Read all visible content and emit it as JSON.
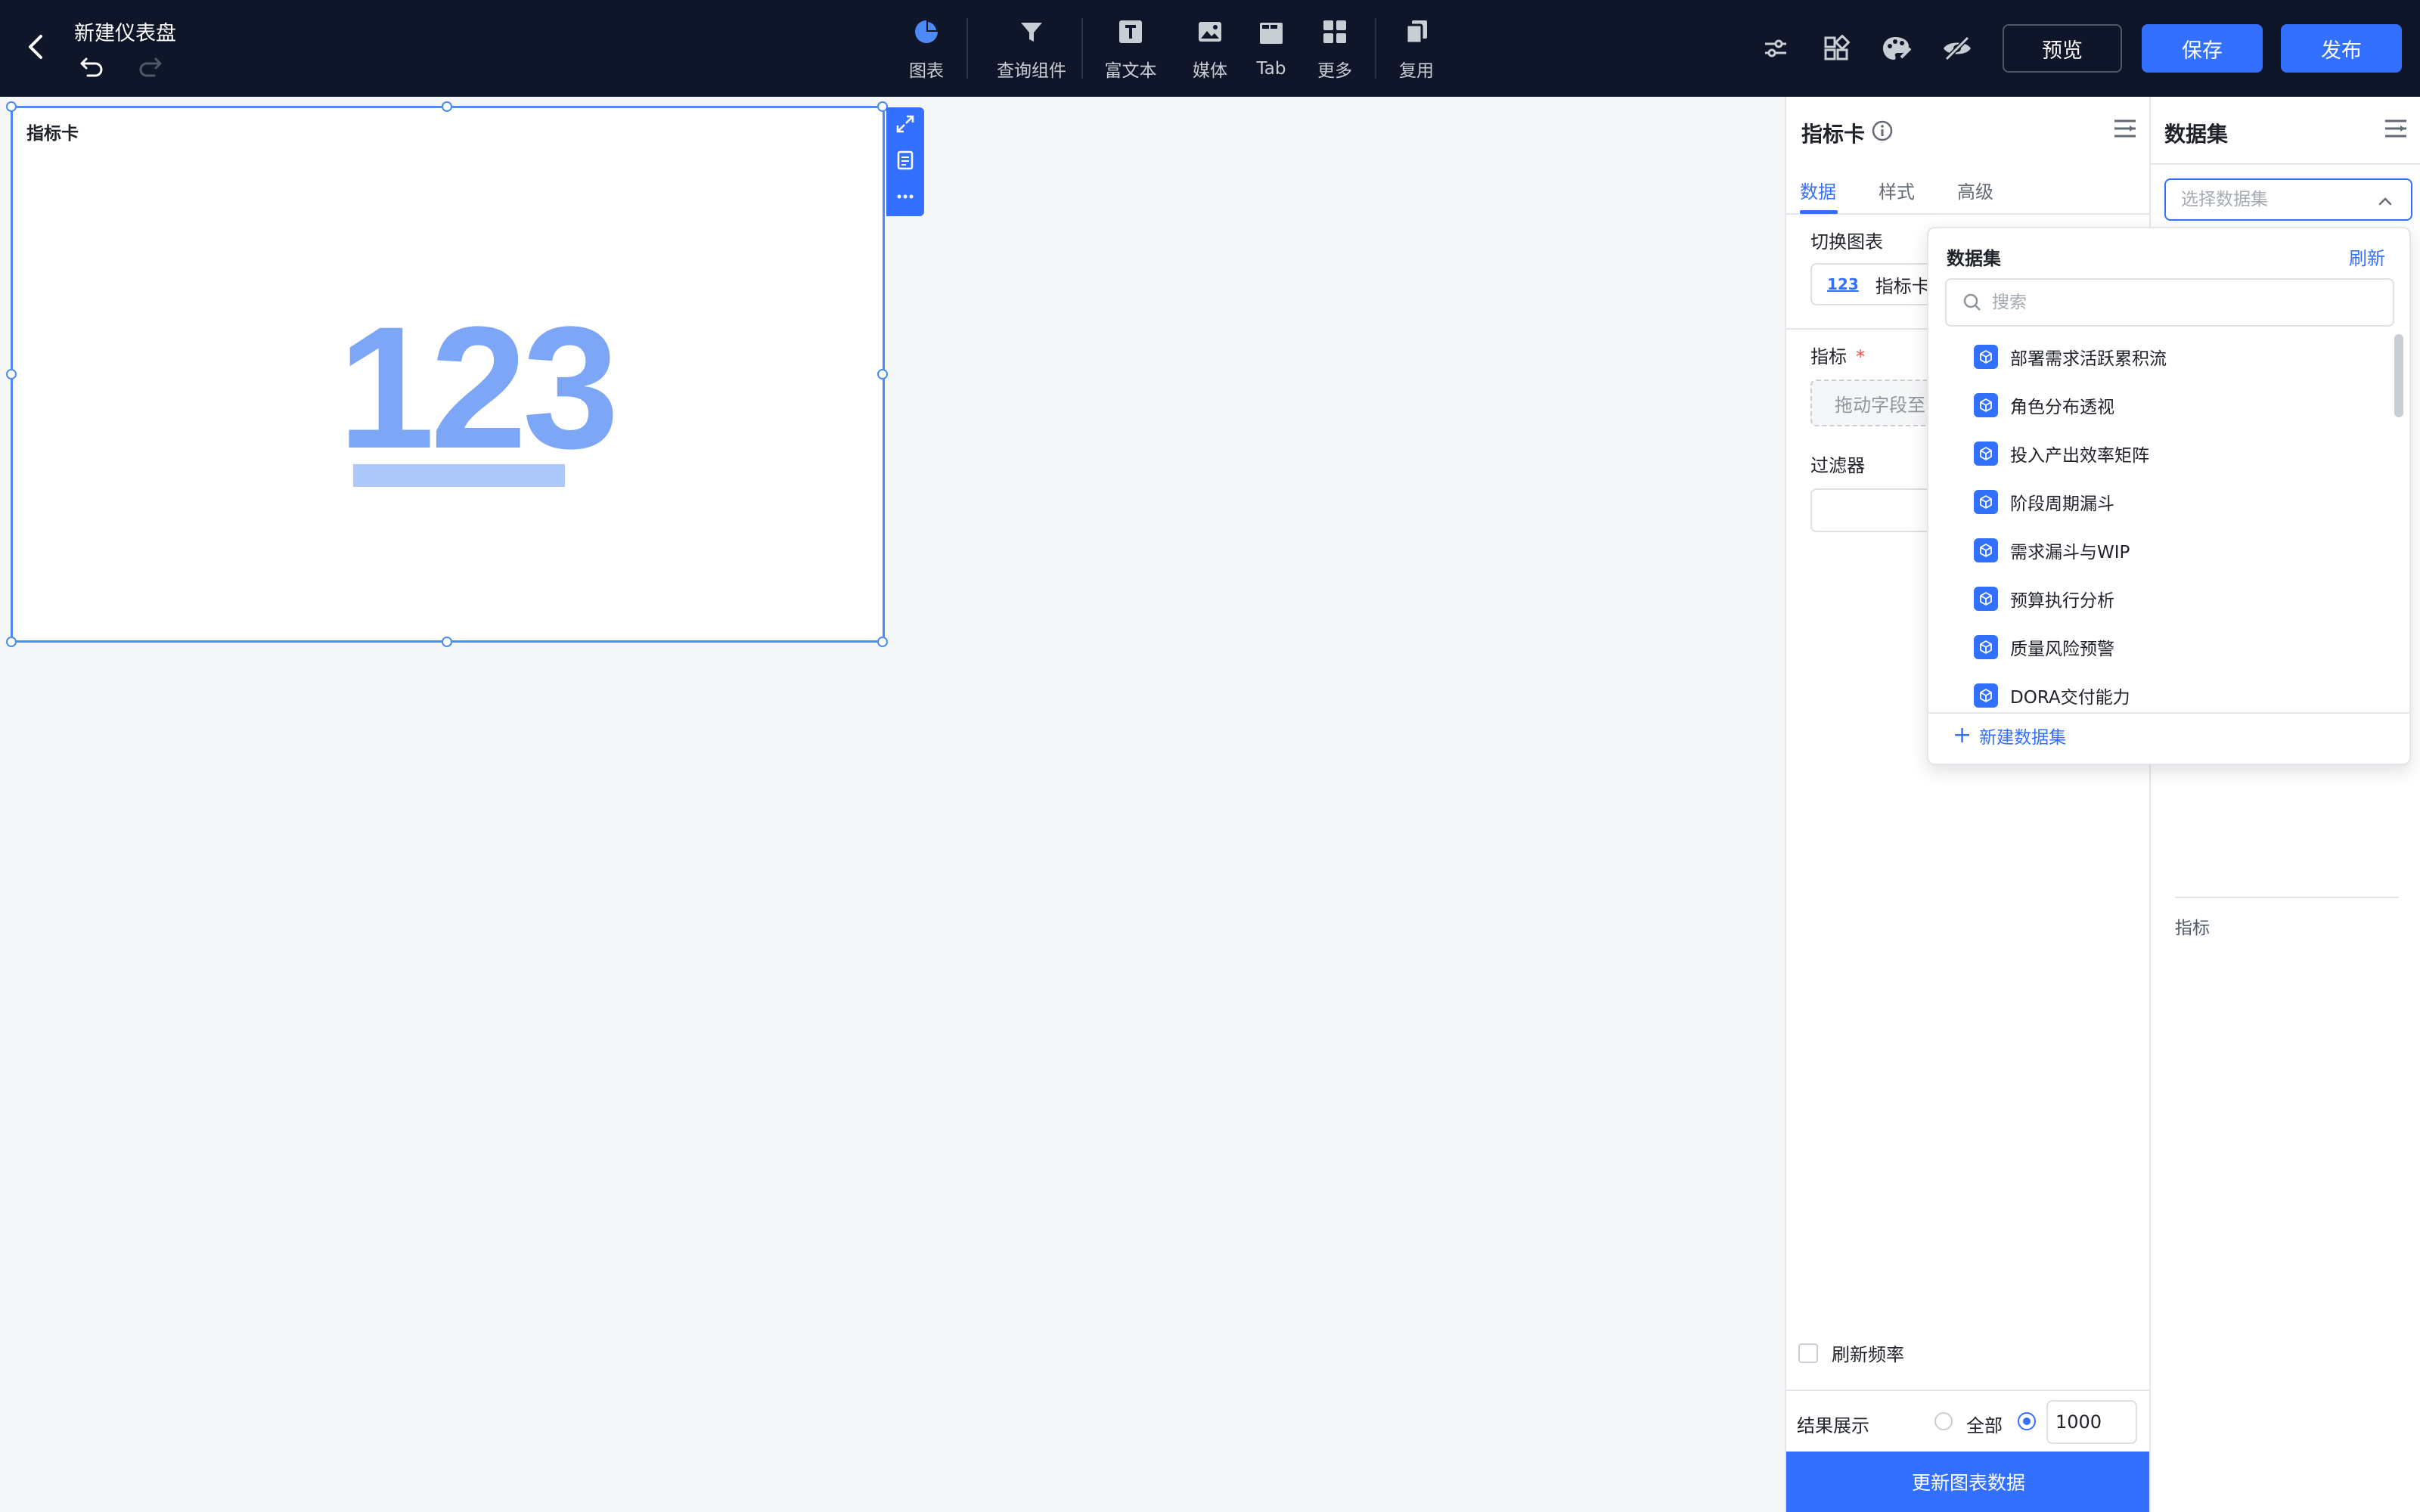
{
  "header": {
    "title": "新建仪表盘",
    "toolbar": [
      {
        "label": "图表",
        "icon": "pie-chart-icon"
      },
      {
        "label": "查询组件",
        "icon": "filter-funnel-icon"
      },
      {
        "label": "富文本",
        "icon": "rich-text-icon"
      },
      {
        "label": "媒体",
        "icon": "image-icon"
      },
      {
        "label": "Tab",
        "icon": "tab-icon"
      },
      {
        "label": "更多",
        "icon": "grid-icon"
      },
      {
        "label": "复用",
        "icon": "copy-icon"
      }
    ],
    "preview_label": "预览",
    "save_label": "保存",
    "publish_label": "发布"
  },
  "canvas": {
    "card_title": "指标卡",
    "metric_placeholder": "123"
  },
  "config_panel": {
    "title": "指标卡",
    "tabs": [
      "数据",
      "样式",
      "高级"
    ],
    "switch_chart_label": "切换图表",
    "chart_type_icon": "123",
    "chart_type_label": "指标卡",
    "metric_label": "指标",
    "required_mark": "*",
    "drop_placeholder": "拖动字段至",
    "filter_label": "过滤器",
    "refresh_label": "刷新频率",
    "result_label": "结果展示",
    "result_all": "全部",
    "result_limit": "1000",
    "update_button": "更新图表数据"
  },
  "dataset_panel": {
    "title": "数据集",
    "select_placeholder": "选择数据集",
    "metric_label": "指标"
  },
  "dataset_dropdown": {
    "title": "数据集",
    "refresh": "刷新",
    "search_placeholder": "搜索",
    "items": [
      "部署需求活跃累积流",
      "角色分布透视",
      "投入产出效率矩阵",
      "阶段周期漏斗",
      "需求漏斗与WIP",
      "预算执行分析",
      "质量风险预警",
      "DORA交付能力"
    ],
    "new_dataset": "新建数据集"
  },
  "colors": {
    "topbar_bg": "#0f1629",
    "accent": "#3370ff",
    "metric_text": "#7ea6f6",
    "metric_bar": "#adc8fb"
  }
}
